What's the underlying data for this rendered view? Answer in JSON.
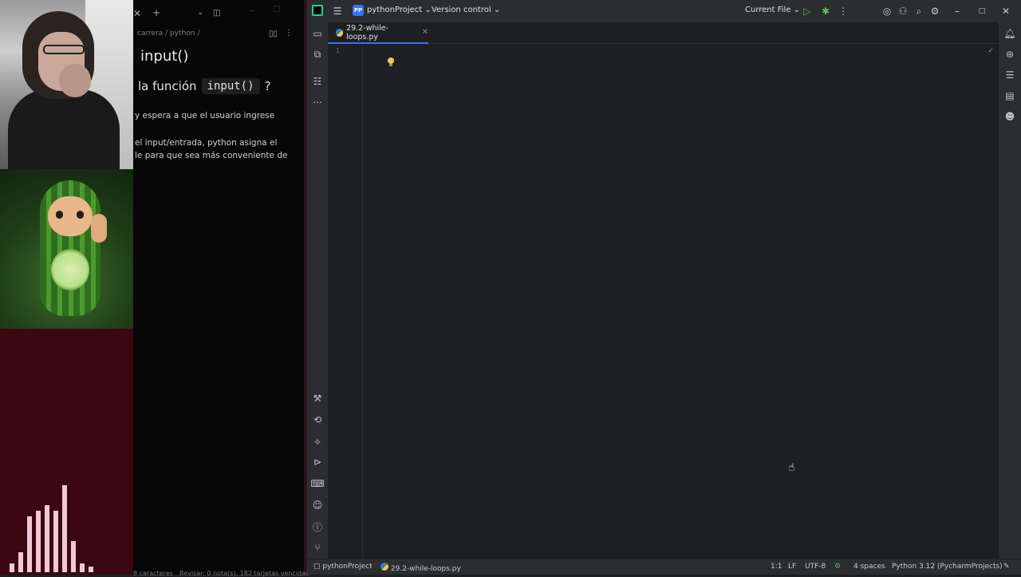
{
  "notes": {
    "breadcrumb": "carrera / python /",
    "heading": "input()",
    "question_prefix": "la función",
    "question_code": "input()",
    "question_suffix": "?",
    "para1": "y espera a que el usuario ingrese",
    "para2_line1": "el input/entrada, python asigna el",
    "para2_line2": "le para que sea más conveniente de",
    "status_left": "8 caracteres",
    "status_right": "Revisar: 0 nota(s), 182 tarjetas vencidas",
    "icons": {
      "close": "close-icon",
      "add": "plus-icon",
      "chevron": "chevron-down-icon",
      "minimize": "minimize-icon",
      "maximize": "maximize-icon",
      "book": "book-icon",
      "more": "more-vertical-icon"
    }
  },
  "visualizer": {
    "bar_levels": [
      0.06,
      0.14,
      0.4,
      0.44,
      0.48,
      0.44,
      0.62,
      0.22,
      0.06,
      0.04
    ]
  },
  "ide": {
    "project_badge": "PP",
    "project_name": "pythonProject",
    "vcs_label": "Version control",
    "run_config": "Current File",
    "tab_file": "29.2-while-loops.py",
    "line_number": "1",
    "status": {
      "project": "pythonProject",
      "file": "29.2-while-loops.py",
      "position": "1:1",
      "line_sep": "LF",
      "encoding": "UTF-8",
      "indent": "4 spaces",
      "interpreter": "Python 3.12 (PycharmProjects)"
    },
    "colors": {
      "accent": "#3574f0",
      "run": "#5fb865",
      "bulb": "#f2c94c"
    }
  }
}
